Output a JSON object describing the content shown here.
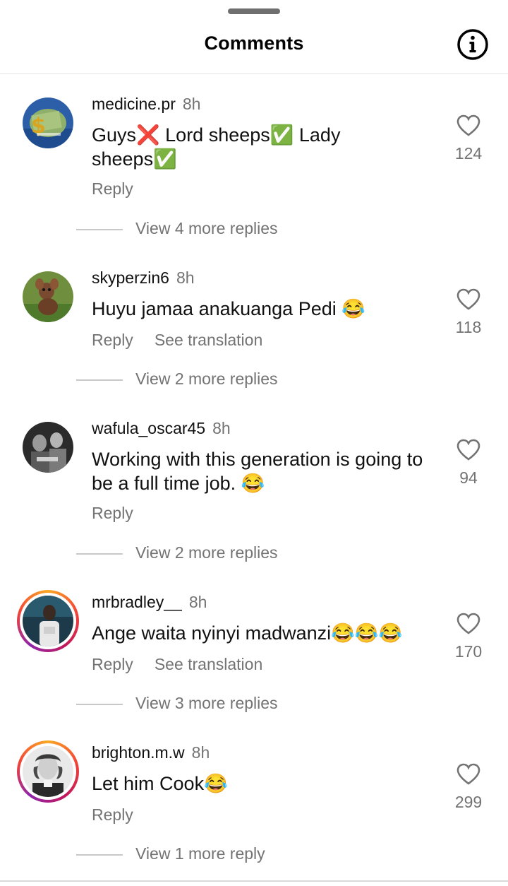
{
  "header": {
    "title": "Comments",
    "info_icon": "info-circle-icon"
  },
  "comments": [
    {
      "username": "medicine.pr",
      "time": "8h",
      "segments": [
        "Guys",
        "❌",
        " Lord sheeps",
        "✅",
        " Lady sheeps",
        "✅"
      ],
      "reply": "Reply",
      "see_translation": "",
      "likes": "124",
      "more_replies": "View 4 more replies",
      "story_ring": false
    },
    {
      "username": "skyperzin6",
      "time": "8h",
      "segments": [
        "Huyu jamaa anakuanga Pedi ",
        "😂"
      ],
      "reply": "Reply",
      "see_translation": "See translation",
      "likes": "118",
      "more_replies": "View 2 more replies",
      "story_ring": false
    },
    {
      "username": "wafula_oscar45",
      "time": "8h",
      "segments": [
        "Working with this generation is going to be a full time job. ",
        "😂"
      ],
      "reply": "Reply",
      "see_translation": "",
      "likes": "94",
      "more_replies": "View 2 more replies",
      "story_ring": false
    },
    {
      "username": "mrbradley__",
      "time": "8h",
      "segments": [
        "Ange waita nyinyi madwanzi",
        "😂",
        "😂",
        "😂"
      ],
      "reply": "Reply",
      "see_translation": "See translation",
      "likes": "170",
      "more_replies": "View 3 more replies",
      "story_ring": true
    },
    {
      "username": "brighton.m.w",
      "time": "8h",
      "segments": [
        "Let him Cook",
        "😂"
      ],
      "reply": "Reply",
      "see_translation": "",
      "likes": "299",
      "more_replies": "View 1 more reply",
      "story_ring": true
    }
  ],
  "colors": {
    "secondary_text": "#737373",
    "divider": "#e4e4e4"
  }
}
